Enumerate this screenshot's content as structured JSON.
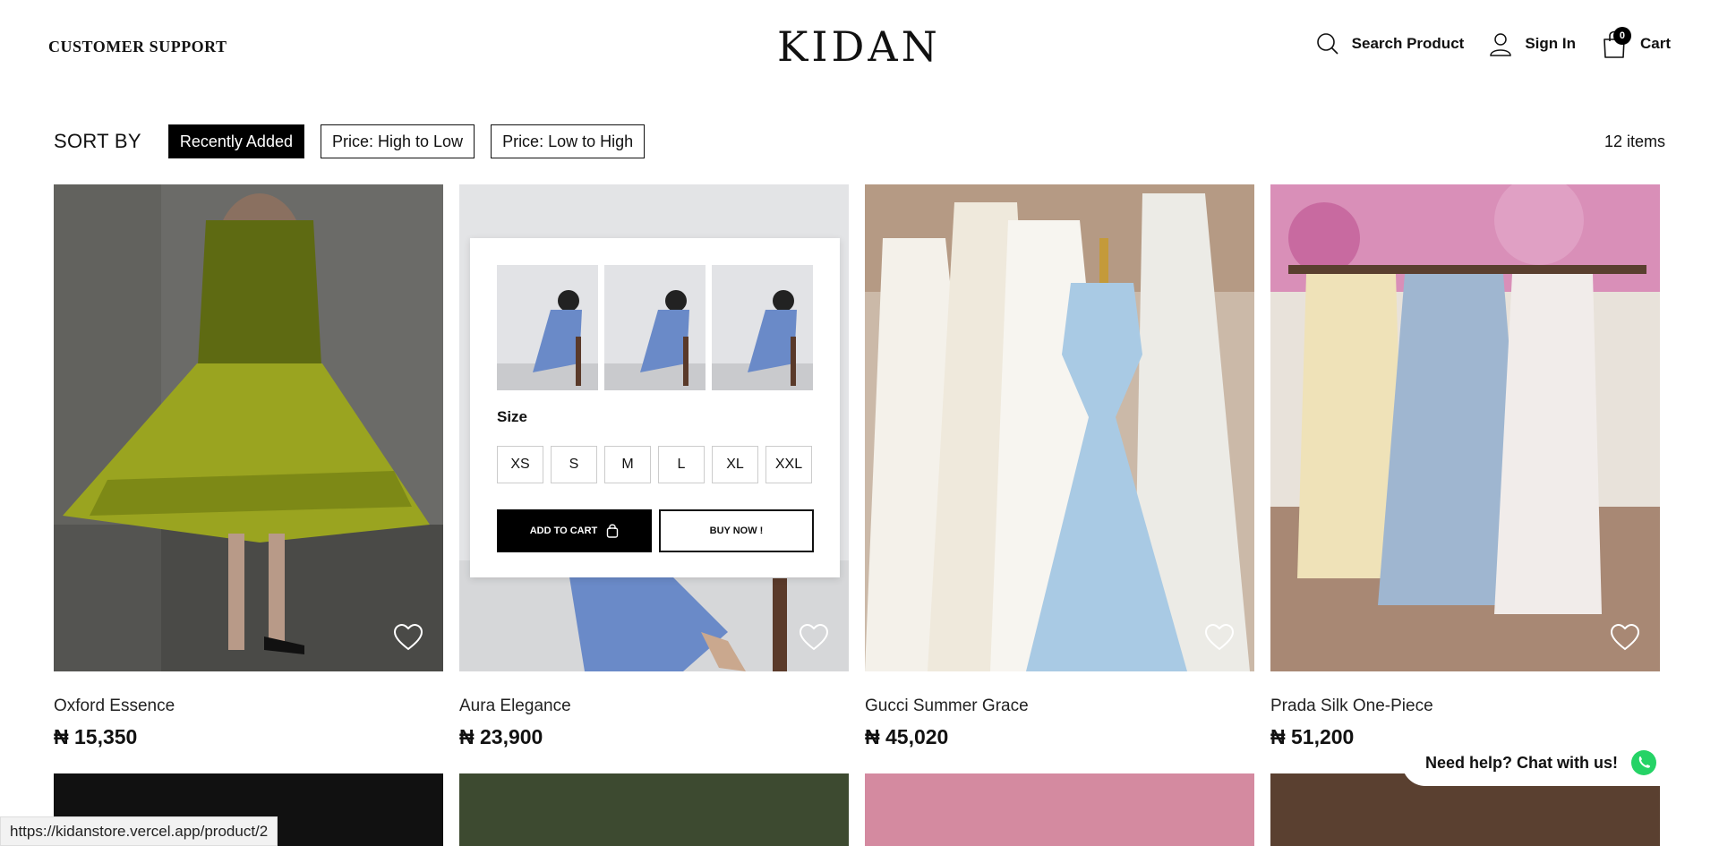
{
  "header": {
    "support": "CUSTOMER SUPPORT",
    "logo": "KIDAN",
    "search_label": "Search Product",
    "signin_label": "Sign In",
    "cart_label": "Cart",
    "cart_count": "0"
  },
  "sort": {
    "label": "SORT BY",
    "options": [
      "Recently Added",
      "Price: High to Low",
      "Price: Low to High"
    ],
    "active": "Recently Added",
    "item_count": "12 items"
  },
  "products": [
    {
      "name": "Oxford Essence",
      "price": "₦ 15,350"
    },
    {
      "name": "Aura Elegance",
      "price": "₦ 23,900"
    },
    {
      "name": "Gucci Summer Grace",
      "price": "₦ 45,020"
    },
    {
      "name": "Prada Silk One-Piece",
      "price": "₦ 51,200"
    }
  ],
  "quick_view": {
    "size_label": "Size",
    "sizes": [
      "XS",
      "S",
      "M",
      "L",
      "XL",
      "XXL"
    ],
    "add_to_cart": "ADD TO CART",
    "buy_now": "BUY NOW !"
  },
  "chat": {
    "label": "Need help? Chat with us!"
  },
  "status_url": "https://kidanstore.vercel.app/product/2",
  "colors": {
    "primary": "#000000",
    "whatsapp": "#25D366"
  }
}
